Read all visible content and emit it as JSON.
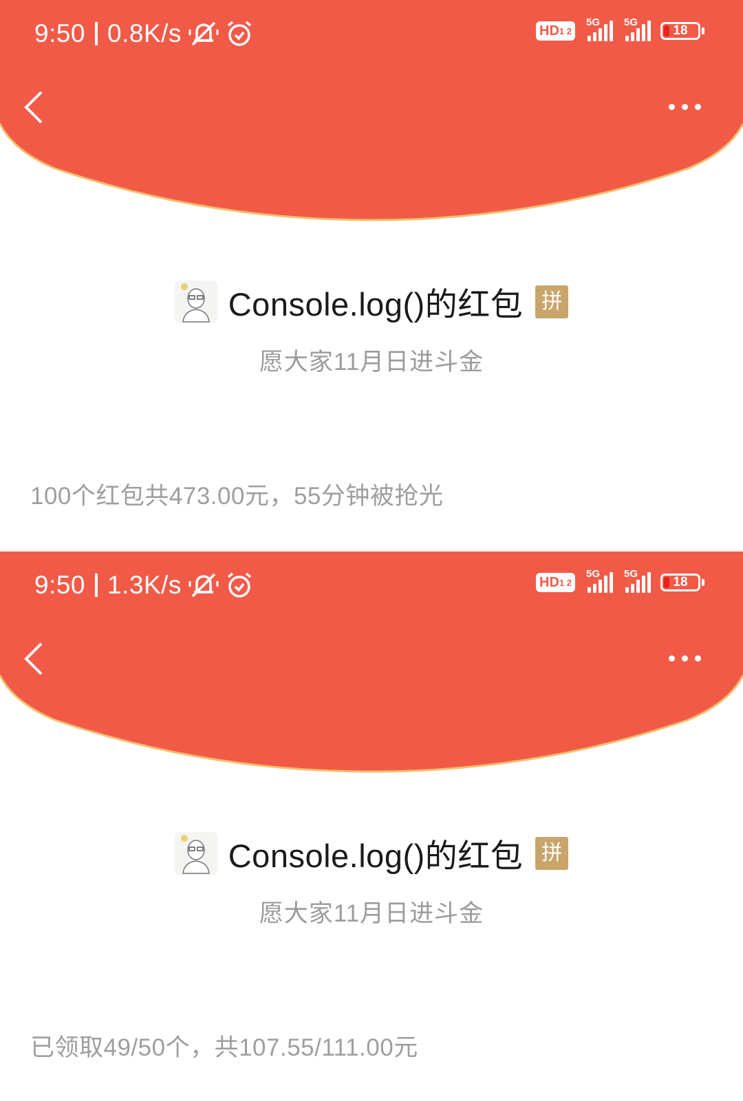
{
  "colors": {
    "header_red": "#f25a48",
    "arc_edge": "#f0c070",
    "pin_badge": "#c8a56b",
    "battery_low": "#e8221d"
  },
  "screens": [
    {
      "status": {
        "time": "9:50",
        "speed": "0.8K/s",
        "hd": "HD",
        "hd_sub": "1 2",
        "signal1": "5G",
        "signal2": "5G",
        "battery": "18"
      },
      "nav": {
        "back_icon": "chevron-left-icon",
        "more_icon": "more-dots-icon"
      },
      "sender_name": "Console.log()的红包",
      "pin_label": "拼",
      "greeting": "愿大家11月日进斗金",
      "summary": "100个红包共473.00元，55分钟被抢光"
    },
    {
      "status": {
        "time": "9:50",
        "speed": "1.3K/s",
        "hd": "HD",
        "hd_sub": "1 2",
        "signal1": "5G",
        "signal2": "5G",
        "battery": "18"
      },
      "nav": {
        "back_icon": "chevron-left-icon",
        "more_icon": "more-dots-icon"
      },
      "sender_name": "Console.log()的红包",
      "pin_label": "拼",
      "greeting": "愿大家11月日进斗金",
      "summary": "已领取49/50个，共107.55/111.00元"
    }
  ]
}
